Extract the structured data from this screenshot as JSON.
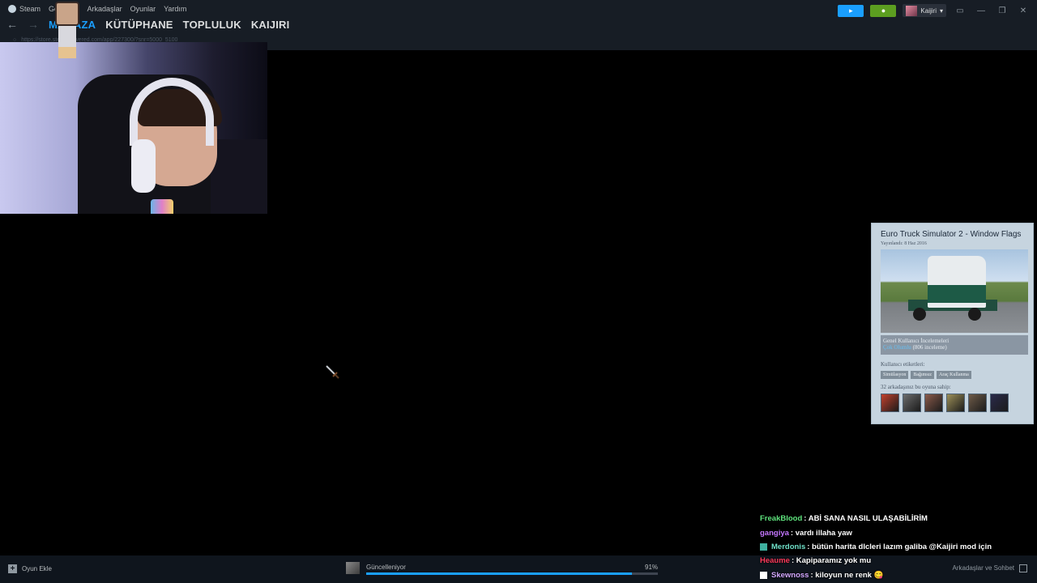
{
  "menu": {
    "items": [
      "Steam",
      "Görünüm",
      "Arkadaşlar",
      "Oyunlar",
      "Yardım"
    ]
  },
  "nav": {
    "tabs": [
      "MAĞAZA",
      "KÜTÜPHANE",
      "TOPLULUK",
      "KAIJIRI"
    ],
    "active_tab": "MAĞAZA",
    "url": "https://store.steampowered.com/app/227300/?snr=5000_5100"
  },
  "topright": {
    "username": "Kaijiri"
  },
  "card": {
    "title": "Euro Truck Simulator 2 - Window Flags",
    "release": "Yayınlandı: 8 Haz 2016",
    "reviews_heading": "Genel Kullanıcı İncelemeleri",
    "reviews_rating": "Çok Olumlu",
    "reviews_count": "(806 inceleme)",
    "tags_label": "Kullanıcı etiketleri:",
    "tags": [
      "Simülasyon",
      "Bağımsız",
      "Araç Kullanma"
    ],
    "friends_text": "32 arkadaşınız bu oyuna sahip:",
    "friend_avatar_colors": [
      "#c2402c",
      "#6b6b6b",
      "#8a5a4a",
      "#9c8f58",
      "#6e5a48",
      "#2a2a4a"
    ]
  },
  "bottom": {
    "add_game": "Oyun Ekle",
    "update_label": "Güncelleniyor",
    "update_percent": "91%",
    "update_progress": 0.91,
    "friends_chat": "Arkadaşlar ve Sohbet"
  },
  "chat": {
    "messages": [
      {
        "user": "FreakBlood",
        "color": "#5ee37d",
        "text": ": ABİ SANA NASIL ULAŞABİLİRİM",
        "badge": ""
      },
      {
        "user": "gangiya",
        "color": "#c476ff",
        "text": ": vardı illaha yaw",
        "badge": ""
      },
      {
        "user": "Merdonis",
        "color": "#6fe0c8",
        "text": ": bütün harita dlcleri lazım galiba @Kaijiri mod için",
        "badge": "#3fb0a0"
      },
      {
        "user": "Heaume",
        "color": "#ff3b5c",
        "text": ": Kapiparamız yok mu",
        "badge": ""
      },
      {
        "user": "Skewnoss",
        "color": "#d2a8ff",
        "text": ": kiloyun ne renk 😋",
        "badge": "#ffffff"
      }
    ]
  },
  "colors": {
    "accent": "#1a9fff",
    "topbar": "#171d25",
    "card_bg": "#c6d4df"
  }
}
